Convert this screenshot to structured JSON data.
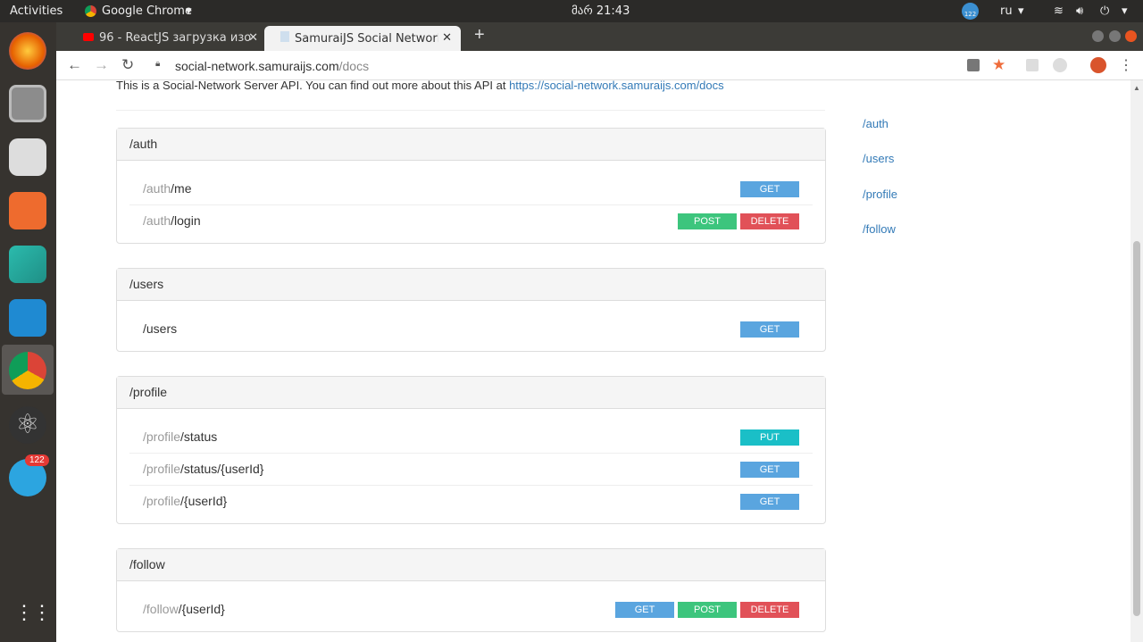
{
  "system": {
    "activities": "Activities",
    "app": "Google Chrome",
    "clock": "მარ 21:43",
    "lang": "ru",
    "badge": "122"
  },
  "tabs": [
    {
      "label": "96 - ReactJS загрузка изо"
    },
    {
      "label": "SamuraiJS Social Network"
    }
  ],
  "address": {
    "host": "social-network.samuraijs.com",
    "path": "/docs"
  },
  "intro": {
    "text": "This is a Social-Network Server API. You can find out more about this API at ",
    "link": "https://social-network.samuraijs.com/docs"
  },
  "sections": [
    {
      "title": "/auth",
      "rows": [
        {
          "pre": "/auth",
          "path": "/me",
          "methods": [
            "GET"
          ]
        },
        {
          "pre": "/auth",
          "path": "/login",
          "methods": [
            "POST",
            "DELETE"
          ]
        }
      ]
    },
    {
      "title": "/users",
      "rows": [
        {
          "pre": "",
          "path": "/users",
          "methods": [
            "GET"
          ]
        }
      ]
    },
    {
      "title": "/profile",
      "rows": [
        {
          "pre": "/profile",
          "path": "/status",
          "methods": [
            "PUT"
          ]
        },
        {
          "pre": "/profile",
          "path": "/status/{userId}",
          "methods": [
            "GET"
          ]
        },
        {
          "pre": "/profile",
          "path": "/{userId}",
          "methods": [
            "GET"
          ]
        }
      ]
    },
    {
      "title": "/follow",
      "rows": [
        {
          "pre": "/follow",
          "path": "/{userId}",
          "methods": [
            "GET",
            "POST",
            "DELETE"
          ]
        }
      ]
    }
  ],
  "nav": [
    "/auth",
    "/users",
    "/profile",
    "/follow"
  ]
}
